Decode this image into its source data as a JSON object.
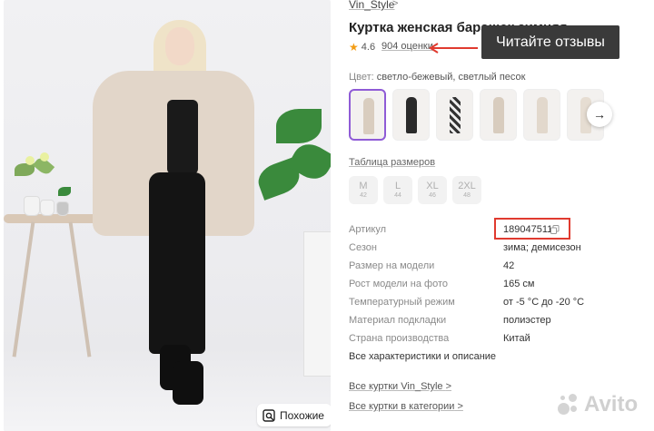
{
  "photo": {
    "similar_button": "Похожие",
    "similar_icon": "search-image-icon"
  },
  "product": {
    "brand": "Vin_Style",
    "title": "Куртка женская барашек зимняя",
    "rating": "4.6",
    "reviews": "904 оценки",
    "tooltip": "Читайте отзывы",
    "color_label": "Цвет:",
    "color_value": "светло-бежевый, светлый песок",
    "swatch_count": 7,
    "size_table_link": "Таблица размеров",
    "sizes": [
      {
        "label": "M",
        "num": "42"
      },
      {
        "label": "L",
        "num": "44"
      },
      {
        "label": "XL",
        "num": "46"
      },
      {
        "label": "2XL",
        "num": "48"
      }
    ],
    "specs": [
      {
        "key": "Артикул",
        "value": "189047511"
      },
      {
        "key": "Сезон",
        "value": "зима; демисезон"
      },
      {
        "key": "Размер на модели",
        "value": "42"
      },
      {
        "key": "Рост модели на фото",
        "value": "165 см"
      },
      {
        "key": "Температурный режим",
        "value": "от -5 °C до -20 °C"
      },
      {
        "key": "Материал подкладки",
        "value": "полиэстер"
      },
      {
        "key": "Страна производства",
        "value": "Китай"
      }
    ],
    "all_characteristics": "Все характеристики и описание",
    "links": [
      {
        "label": "Все куртки Vin_Style"
      },
      {
        "label": "Все куртки в категории"
      }
    ]
  },
  "watermark": "Avito",
  "colors": {
    "accent_purple": "#8f5bd6",
    "highlight_red": "#e03a2f",
    "star": "#f39c12",
    "tooltip_bg": "#3a3a3a"
  }
}
